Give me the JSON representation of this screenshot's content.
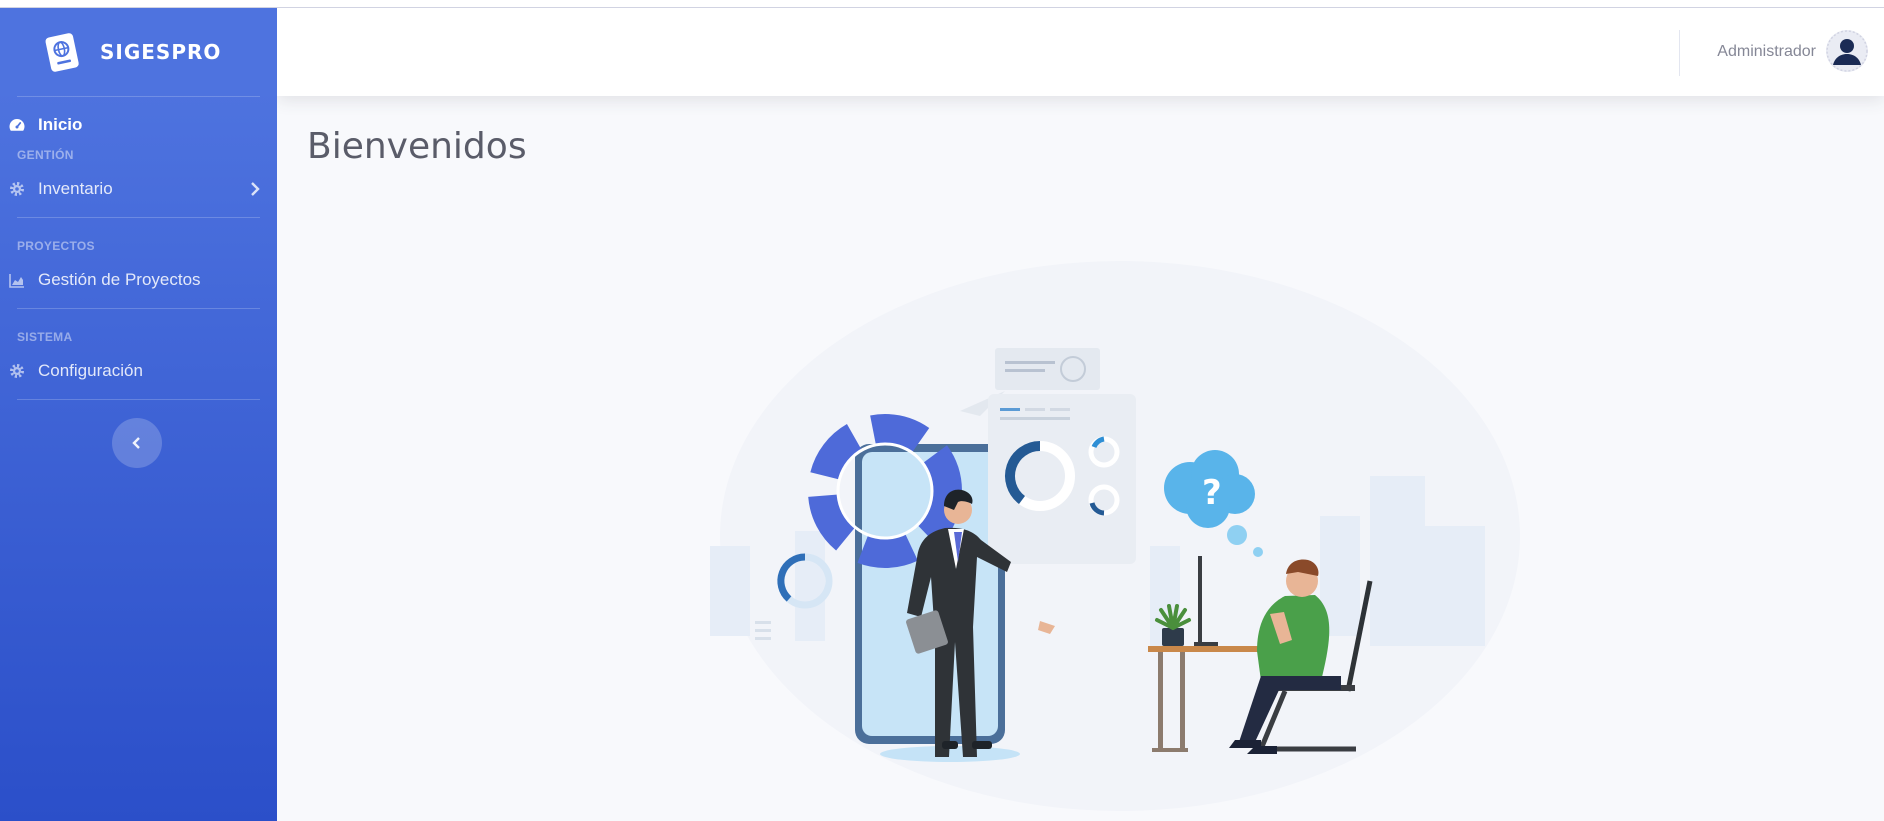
{
  "brand": {
    "name": "SIGESPRO",
    "icon": "passport-globe-icon"
  },
  "sidebar": {
    "items": [
      {
        "label": "Inicio",
        "icon": "tachometer-icon",
        "active": true
      },
      {
        "label": "Inventario",
        "icon": "gear-icon",
        "has_submenu": true
      },
      {
        "label": "Gestión de Proyectos",
        "icon": "area-chart-icon"
      },
      {
        "label": "Configuración",
        "icon": "gear-icon"
      }
    ],
    "headings": [
      "GENTIÓN",
      "PROYECTOS",
      "SISTEMA"
    ],
    "toggle_icon": "chevron-left-icon"
  },
  "topbar": {
    "user_name": "Administrador",
    "avatar_icon": "user-avatar-icon"
  },
  "main": {
    "title": "Bienvenidos",
    "illustration": "business-meeting-illustration"
  },
  "colors": {
    "sidebar_top": "#4e73df",
    "sidebar_bottom": "#2b4fc9",
    "background": "#f8f9fc",
    "title": "#5a5c69"
  }
}
